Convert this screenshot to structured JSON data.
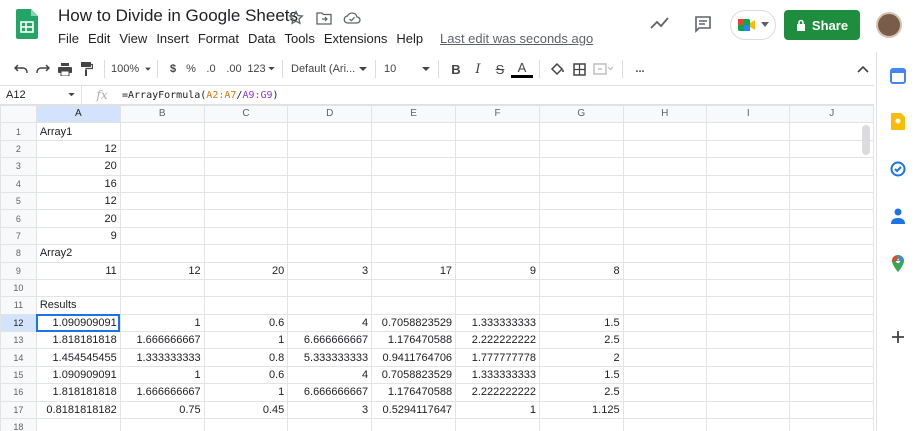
{
  "doc_title": "How to Divide in Google Sheets",
  "menus": [
    "File",
    "Edit",
    "View",
    "Insert",
    "Format",
    "Data",
    "Tools",
    "Extensions",
    "Help"
  ],
  "last_edit": "Last edit was seconds ago",
  "share_label": "Share",
  "toolbar": {
    "zoom": "100%",
    "currency": "$",
    "percent": "%",
    "dec_less": ".0",
    "dec_more": ".00",
    "num_format": "123",
    "font": "Default (Ari...",
    "font_size": "10",
    "bold": "B",
    "italic": "I",
    "strike": "S",
    "text_color": "A",
    "more": "..."
  },
  "namebox": "A12",
  "fx": "fx",
  "formula": {
    "prefix": "=ArrayFormula(",
    "ref1": "A2:A7",
    "slash": "/",
    "ref2": "A9:G9",
    "suffix": ")"
  },
  "columns": [
    "A",
    "B",
    "C",
    "D",
    "E",
    "F",
    "G",
    "H",
    "I",
    "J"
  ],
  "rows": [
    {
      "n": "1",
      "cells": [
        {
          "v": "Array1",
          "t": "txt"
        },
        "",
        "",
        "",
        "",
        "",
        "",
        "",
        "",
        ""
      ]
    },
    {
      "n": "2",
      "cells": [
        {
          "v": "12",
          "t": "num"
        },
        "",
        "",
        "",
        "",
        "",
        "",
        "",
        "",
        ""
      ]
    },
    {
      "n": "3",
      "cells": [
        {
          "v": "20",
          "t": "num"
        },
        "",
        "",
        "",
        "",
        "",
        "",
        "",
        "",
        ""
      ]
    },
    {
      "n": "4",
      "cells": [
        {
          "v": "16",
          "t": "num"
        },
        "",
        "",
        "",
        "",
        "",
        "",
        "",
        "",
        ""
      ]
    },
    {
      "n": "5",
      "cells": [
        {
          "v": "12",
          "t": "num"
        },
        "",
        "",
        "",
        "",
        "",
        "",
        "",
        "",
        ""
      ]
    },
    {
      "n": "6",
      "cells": [
        {
          "v": "20",
          "t": "num"
        },
        "",
        "",
        "",
        "",
        "",
        "",
        "",
        "",
        ""
      ]
    },
    {
      "n": "7",
      "cells": [
        {
          "v": "9",
          "t": "num"
        },
        "",
        "",
        "",
        "",
        "",
        "",
        "",
        "",
        ""
      ]
    },
    {
      "n": "8",
      "cells": [
        {
          "v": "Array2",
          "t": "txt"
        },
        "",
        "",
        "",
        "",
        "",
        "",
        "",
        "",
        ""
      ]
    },
    {
      "n": "9",
      "cells": [
        {
          "v": "11",
          "t": "num"
        },
        {
          "v": "12",
          "t": "num"
        },
        {
          "v": "20",
          "t": "num"
        },
        {
          "v": "3",
          "t": "num"
        },
        {
          "v": "17",
          "t": "num"
        },
        {
          "v": "9",
          "t": "num"
        },
        {
          "v": "8",
          "t": "num"
        },
        "",
        "",
        ""
      ]
    },
    {
      "n": "10",
      "cells": [
        "",
        "",
        "",
        "",
        "",
        "",
        "",
        "",
        "",
        ""
      ]
    },
    {
      "n": "11",
      "cells": [
        {
          "v": "Results",
          "t": "txt"
        },
        "",
        "",
        "",
        "",
        "",
        "",
        "",
        "",
        ""
      ]
    },
    {
      "n": "12",
      "cells": [
        {
          "v": "1.090909091",
          "t": "num"
        },
        {
          "v": "1",
          "t": "num"
        },
        {
          "v": "0.6",
          "t": "num"
        },
        {
          "v": "4",
          "t": "num"
        },
        {
          "v": "0.7058823529",
          "t": "num"
        },
        {
          "v": "1.333333333",
          "t": "num"
        },
        {
          "v": "1.5",
          "t": "num"
        },
        "",
        "",
        ""
      ]
    },
    {
      "n": "13",
      "cells": [
        {
          "v": "1.818181818",
          "t": "num"
        },
        {
          "v": "1.666666667",
          "t": "num"
        },
        {
          "v": "1",
          "t": "num"
        },
        {
          "v": "6.666666667",
          "t": "num"
        },
        {
          "v": "1.176470588",
          "t": "num"
        },
        {
          "v": "2.222222222",
          "t": "num"
        },
        {
          "v": "2.5",
          "t": "num"
        },
        "",
        "",
        ""
      ]
    },
    {
      "n": "14",
      "cells": [
        {
          "v": "1.454545455",
          "t": "num"
        },
        {
          "v": "1.333333333",
          "t": "num"
        },
        {
          "v": "0.8",
          "t": "num"
        },
        {
          "v": "5.333333333",
          "t": "num"
        },
        {
          "v": "0.9411764706",
          "t": "num"
        },
        {
          "v": "1.777777778",
          "t": "num"
        },
        {
          "v": "2",
          "t": "num"
        },
        "",
        "",
        ""
      ]
    },
    {
      "n": "15",
      "cells": [
        {
          "v": "1.090909091",
          "t": "num"
        },
        {
          "v": "1",
          "t": "num"
        },
        {
          "v": "0.6",
          "t": "num"
        },
        {
          "v": "4",
          "t": "num"
        },
        {
          "v": "0.7058823529",
          "t": "num"
        },
        {
          "v": "1.333333333",
          "t": "num"
        },
        {
          "v": "1.5",
          "t": "num"
        },
        "",
        "",
        ""
      ]
    },
    {
      "n": "16",
      "cells": [
        {
          "v": "1.818181818",
          "t": "num"
        },
        {
          "v": "1.666666667",
          "t": "num"
        },
        {
          "v": "1",
          "t": "num"
        },
        {
          "v": "6.666666667",
          "t": "num"
        },
        {
          "v": "1.176470588",
          "t": "num"
        },
        {
          "v": "2.222222222",
          "t": "num"
        },
        {
          "v": "2.5",
          "t": "num"
        },
        "",
        "",
        ""
      ]
    },
    {
      "n": "17",
      "cells": [
        {
          "v": "0.8181818182",
          "t": "num"
        },
        {
          "v": "0.75",
          "t": "num"
        },
        {
          "v": "0.45",
          "t": "num"
        },
        {
          "v": "3",
          "t": "num"
        },
        {
          "v": "0.5294117647",
          "t": "num"
        },
        {
          "v": "1",
          "t": "num"
        },
        {
          "v": "1.125",
          "t": "num"
        },
        "",
        "",
        ""
      ]
    },
    {
      "n": "18",
      "cells": [
        "",
        "",
        "",
        "",
        "",
        "",
        "",
        "",
        "",
        ""
      ]
    }
  ],
  "colors": {
    "accent": "#1a73e8",
    "share": "#1e8e3e",
    "ref1": "#e8710a",
    "ref2": "#9334e6"
  }
}
